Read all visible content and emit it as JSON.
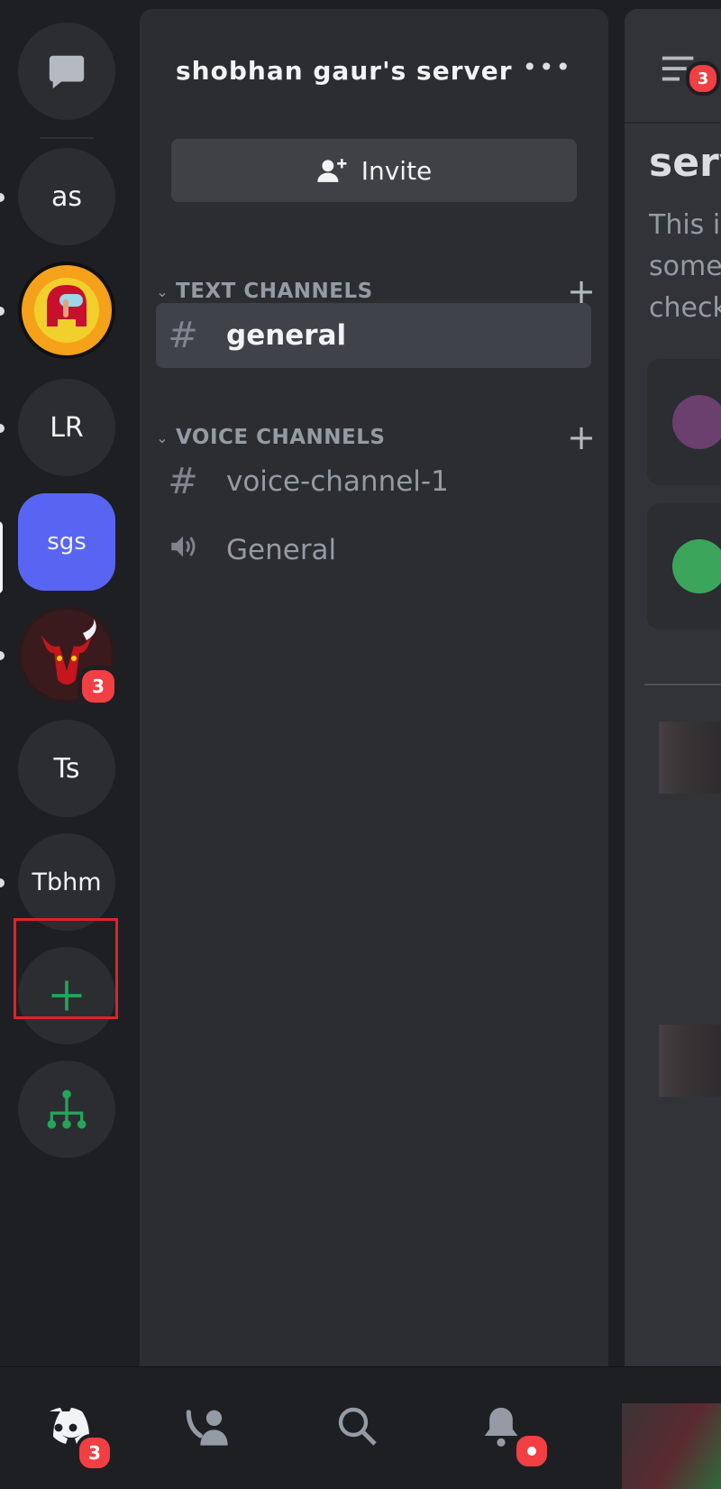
{
  "rail": {
    "servers": [
      {
        "label": "as"
      },
      {
        "label": ""
      },
      {
        "label": "LR"
      },
      {
        "label": "sgs"
      },
      {
        "label": "",
        "badge": "3"
      },
      {
        "label": "Ts"
      },
      {
        "label": "Tbhm"
      }
    ]
  },
  "panel": {
    "server_name": "shobhan gaur's server",
    "more_label": "•••",
    "invite_label": "Invite",
    "text_category": "TEXT CHANNELS",
    "voice_category": "VOICE CHANNELS",
    "channels": [
      {
        "name": "general"
      },
      {
        "name": "voice-channel-1"
      },
      {
        "name": "General"
      }
    ]
  },
  "peek": {
    "header_badge": "3",
    "title": "serv",
    "lines": [
      "This i",
      "some",
      "check"
    ]
  },
  "nav": {
    "home_badge": "3"
  },
  "colors": {
    "blurple": "#5865f2",
    "green": "#23a55a",
    "red": "#f23f43",
    "highlight": "#e0222a"
  }
}
